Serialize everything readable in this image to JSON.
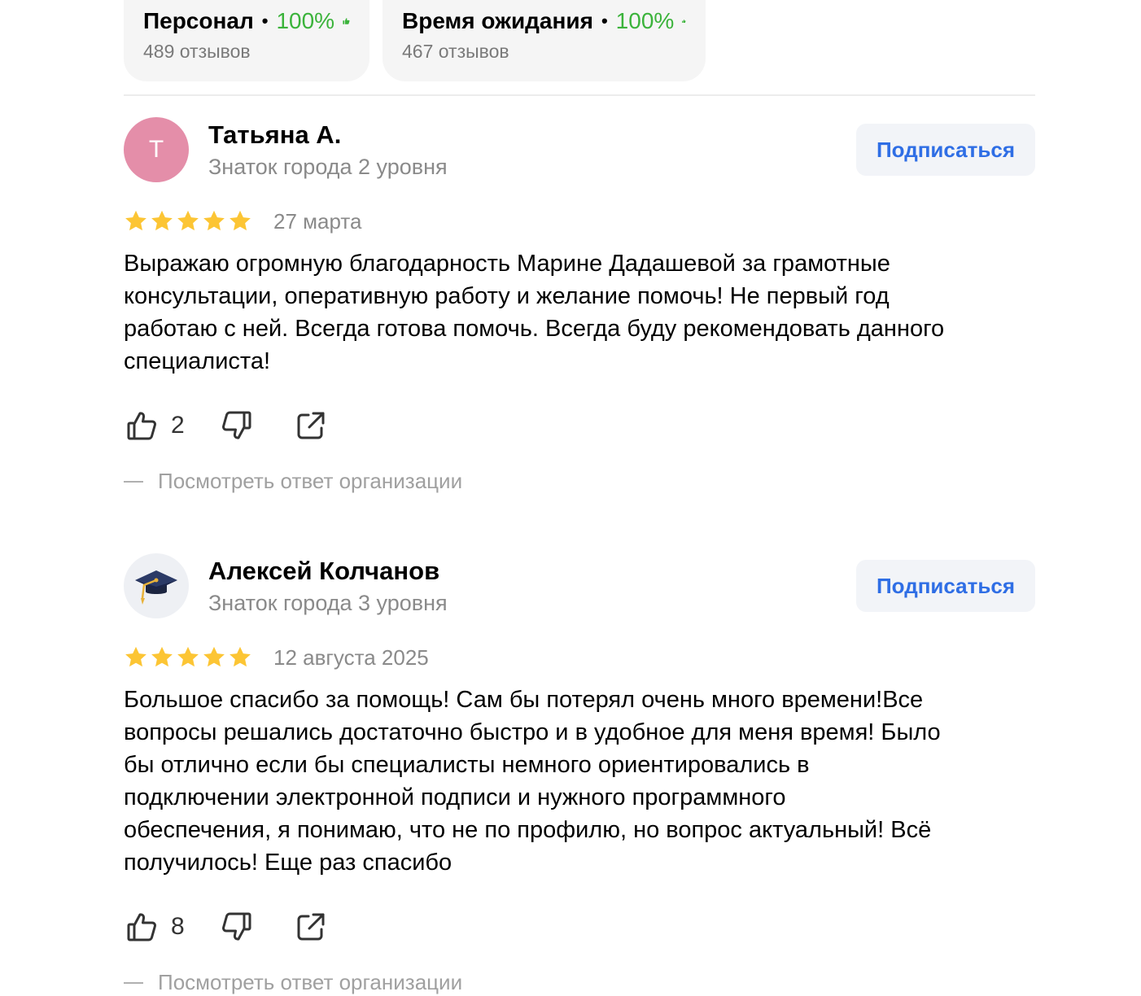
{
  "aspects": [
    {
      "name": "Персонал",
      "separator": "•",
      "percent": "100%",
      "count": "489 отзывов"
    },
    {
      "name": "Время ожидания",
      "separator": "•",
      "percent": "100%",
      "count": "467 отзывов"
    }
  ],
  "colors": {
    "accent_green": "#3bb33b",
    "link_blue": "#2f6ee5",
    "star": "#fcc534",
    "avatar_pink": "#e48ea9"
  },
  "reviews": [
    {
      "avatar_letter": "Т",
      "author": "Татьяна А.",
      "level": "Знаток города 2 уровня",
      "subscribe_label": "Подписаться",
      "rating": 5,
      "date": "27 марта",
      "text": "Выражаю огромную благодарность Марине Дадашевой за грамотные\nконсультации, оперативную работу и желание помочь! Не первый год\nработаю с ней. Всегда готова помочь. Всегда буду рекомендовать данного\nспециалиста!",
      "likes": "2",
      "org_reply_label": "Посмотреть ответ организации"
    },
    {
      "avatar_icon": "graduation-cap-icon",
      "author": "Алексей Колчанов",
      "level": "Знаток города 3 уровня",
      "subscribe_label": "Подписаться",
      "rating": 5,
      "date": "12 августа 2025",
      "text": "Большое спасибо за помощь! Сам бы потерял очень много времени!Все\nвопросы решались достаточно быстро и в удобное для меня время! Было\nбы отлично если бы специалисты немного ориентировались в\nподключении электронной подписи и нужного программного\nобеспечения, я понимаю, что не по профилю, но вопрос актуальный! Всё\nполучилось! Еще раз спасибо",
      "likes": "8",
      "org_reply_label": "Посмотреть ответ организации"
    }
  ]
}
